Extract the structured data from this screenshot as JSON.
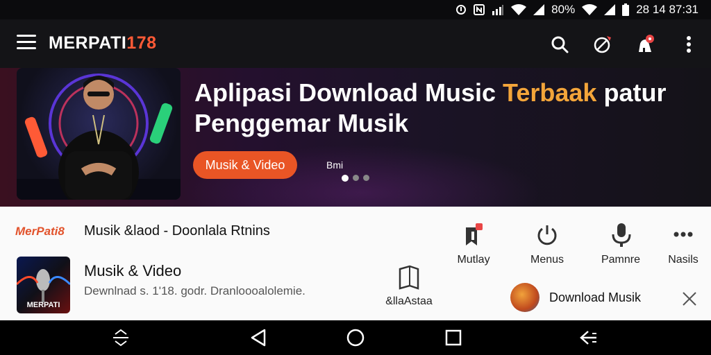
{
  "status_bar": {
    "battery": "80%",
    "time": "28 14 87:31",
    "icons": [
      "sync-icon",
      "nfc-icon",
      "signal-icon",
      "wifi-icon",
      "signal-icon",
      "battery-icon"
    ]
  },
  "app_bar": {
    "brand_main": "MERPATI",
    "brand_number": "178",
    "icons": [
      "menu-icon",
      "search-icon",
      "cast-icon",
      "notification-icon",
      "more-vert-icon"
    ]
  },
  "hero": {
    "title_part1": "Aplipasi Download Music ",
    "title_highlight": "Terbaak",
    "title_part2": " patur Penggemar Musik",
    "button_label": "Musik & Video",
    "side_text": "Bmi",
    "slides": 3,
    "active_slide": 1
  },
  "content": {
    "logo_text": "MerPati8",
    "row1_text": "Musik &laod - Doonlala Rtnins",
    "thumb_text": "MERPATI",
    "item_title": "Musik & Video",
    "item_subtitle": "Dewnlnad s. 1'18. godr. Dranloooalolemie.",
    "actions": [
      {
        "label": "Mutlay",
        "icon": "bookmark-icon"
      },
      {
        "label": "Menus",
        "icon": "power-icon"
      },
      {
        "label": "Pamnre",
        "icon": "microphone-icon"
      },
      {
        "label": "Nasils",
        "icon": "more-horiz-icon"
      }
    ],
    "library_label": "&llaAstaa",
    "download_chip_label": "Download Musik"
  },
  "nav_bar": {
    "icons": [
      "expand-icon",
      "back-icon",
      "home-icon",
      "recents-icon",
      "share-back-icon"
    ]
  },
  "colors": {
    "accent": "#e95525",
    "brand_accent": "#ff5a36",
    "highlight": "#f3a53a"
  }
}
